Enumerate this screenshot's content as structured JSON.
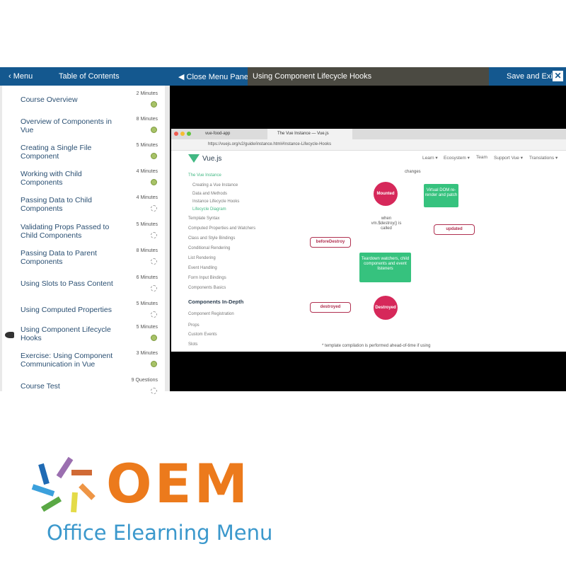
{
  "header": {
    "menu_label": "Menu",
    "toc_label": "Table of Contents",
    "close_panel_label": "Close Menu Panel",
    "lesson_title": "Using Component Lifecycle Hooks",
    "save_exit_label": "Save and Exit",
    "close_label": "✕"
  },
  "toc": [
    {
      "title": "Course Overview",
      "duration": "2 Minutes",
      "status": "complete"
    },
    {
      "title": "Overview of Components in Vue",
      "duration": "8 Minutes",
      "status": "complete"
    },
    {
      "title": "Creating a Single File Component",
      "duration": "5 Minutes",
      "status": "complete"
    },
    {
      "title": "Working with Child Components",
      "duration": "4 Minutes",
      "status": "complete"
    },
    {
      "title": "Passing Data to Child Components",
      "duration": "4 Minutes",
      "status": "incomplete"
    },
    {
      "title": "Validating Props Passed to Child Components",
      "duration": "5 Minutes",
      "status": "incomplete"
    },
    {
      "title": "Passing Data to Parent Components",
      "duration": "8 Minutes",
      "status": "incomplete"
    },
    {
      "title": "Using Slots to Pass Content",
      "duration": "6 Minutes",
      "status": "incomplete"
    },
    {
      "title": "Using Computed Properties",
      "duration": "5 Minutes",
      "status": "incomplete"
    },
    {
      "title": "Using Component Lifecycle Hooks",
      "duration": "5 Minutes",
      "status": "complete",
      "current": true
    },
    {
      "title": "Exercise: Using Component Communication in Vue",
      "duration": "3 Minutes",
      "status": "complete"
    },
    {
      "title": "Course Test",
      "duration": "9 Questions",
      "status": "incomplete"
    }
  ],
  "video": {
    "tabs": [
      "vue-food-app",
      "The Vue Instance — Vue.js"
    ],
    "url": "https://vuejs.org/v2/guide/instance.html#Instance-Lifecycle-Hooks",
    "site_name": "Vue.js",
    "nav": [
      "Learn ▾",
      "Ecosystem ▾",
      "Team",
      "Support Vue ▾",
      "Translations ▾"
    ],
    "sidebar": [
      "The Vue Instance",
      "Creating a Vue Instance",
      "Data and Methods",
      "Instance Lifecycle Hooks",
      "Lifecycle Diagram",
      "Template Syntax",
      "Computed Properties and Watchers",
      "Class and Style Bindings",
      "Conditional Rendering",
      "List Rendering",
      "Event Handling",
      "Form Input Bindings",
      "Components Basics",
      "Components In-Depth",
      "Component Registration",
      "Props",
      "Custom Events",
      "Slots"
    ],
    "diagram": {
      "changes": "changes",
      "mounted": "Mounted",
      "vdom": "Virtual DOM re-render and patch",
      "updated": "updated",
      "when": "when vm.$destroy() is called",
      "before_destroy": "beforeDestroy",
      "teardown": "Teardown watchers, child components and event listeners",
      "destroyed_hook": "destroyed",
      "destroyed": "Destroyed",
      "footnote": "* template compilation is performed ahead-of-time if using"
    }
  },
  "logo": {
    "letters": "OEM",
    "tagline": "Office Elearning Menu"
  },
  "colors": {
    "header_blue": "#14588f",
    "complete": "#a7c267",
    "vue_green": "#42b883",
    "hook_red": "#d6285a",
    "logo_orange": "#ec7a1c",
    "logo_blue": "#3b98cc"
  }
}
